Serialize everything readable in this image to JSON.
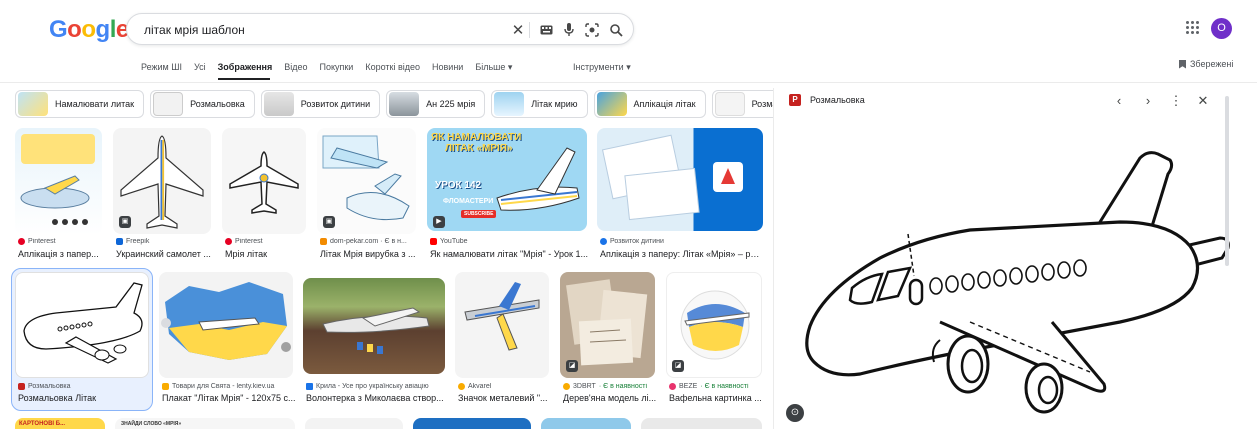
{
  "search": {
    "query": "літак мрія шаблон"
  },
  "logo": [
    "G",
    "o",
    "o",
    "g",
    "l",
    "e"
  ],
  "colors": {
    "blue": "#4285f4",
    "red": "#ea4335",
    "yellow": "#fbbc05",
    "green": "#34a853",
    "avatar": "#6f2fc9"
  },
  "user": {
    "initial": "O"
  },
  "tabs": [
    {
      "label": "Режим ШІ"
    },
    {
      "label": "Усі"
    },
    {
      "label": "Зображення"
    },
    {
      "label": "Відео"
    },
    {
      "label": "Покупки"
    },
    {
      "label": "Короткі відео"
    },
    {
      "label": "Новини"
    },
    {
      "label": "Більше ▾"
    }
  ],
  "tools_label": "Інструменти ▾",
  "saved_label": "Збережені",
  "chips": [
    "Намалювати литак",
    "Розмальовка",
    "Розвиток дитини",
    "Ан 225 мрія",
    "Літак мрию",
    "Аплікація літак",
    "Розмальовка літак"
  ],
  "row1": [
    {
      "source": "Pinterest",
      "title": "Аплікація з папер..."
    },
    {
      "source": "Freepik",
      "title": "Украинский самолет ..."
    },
    {
      "source": "Pinterest",
      "title": "Мрія літак"
    },
    {
      "source": "dom-pekar.com · Є в н...",
      "title": "Літак Мрія вирубка з ..."
    },
    {
      "source": "YouTube",
      "title": "Як намалювати літак \"Мрія\" - Урок 1..."
    },
    {
      "source": "Розвиток дитини",
      "title": "Аплікація з паперу: Літак «Мрія» – роз..."
    }
  ],
  "row2": [
    {
      "source": "Розмальовка",
      "title": "Розмальовка Літак"
    },
    {
      "source": "Товари для Свята - lenty.kiev.ua",
      "title": "Плакат \"Літак Мрія\" - 120x75 с..."
    },
    {
      "source": "Крила - Усе про українську авіацію",
      "title": "Волонтерка з Миколаєва створ..."
    },
    {
      "source": "Akvarel",
      "title": "Значок металевий \"..."
    },
    {
      "source": "3DBRT",
      "stock": "· Є в наявності",
      "title": "Дерев'яна модель лі..."
    },
    {
      "source": "BEZE",
      "stock": "· Є в наявності",
      "title": "Вафельна картинка ..."
    }
  ],
  "row3": {
    "banner": "КАРТОНОВІ Б...",
    "words": "ЗНАЙДИ СЛОВО «МРІЯ»"
  },
  "youtube_thumb": {
    "line1": "ЯК НАМАЛЮВАТИ",
    "line2": "ЛІТАК «МРІЯ»",
    "lesson": "УРОК 142",
    "sub": "ФЛОМАСТЕРИ",
    "subscribe": "SUBSCRIBE"
  },
  "preview": {
    "source": "Розмальовка",
    "favicon": "P"
  }
}
